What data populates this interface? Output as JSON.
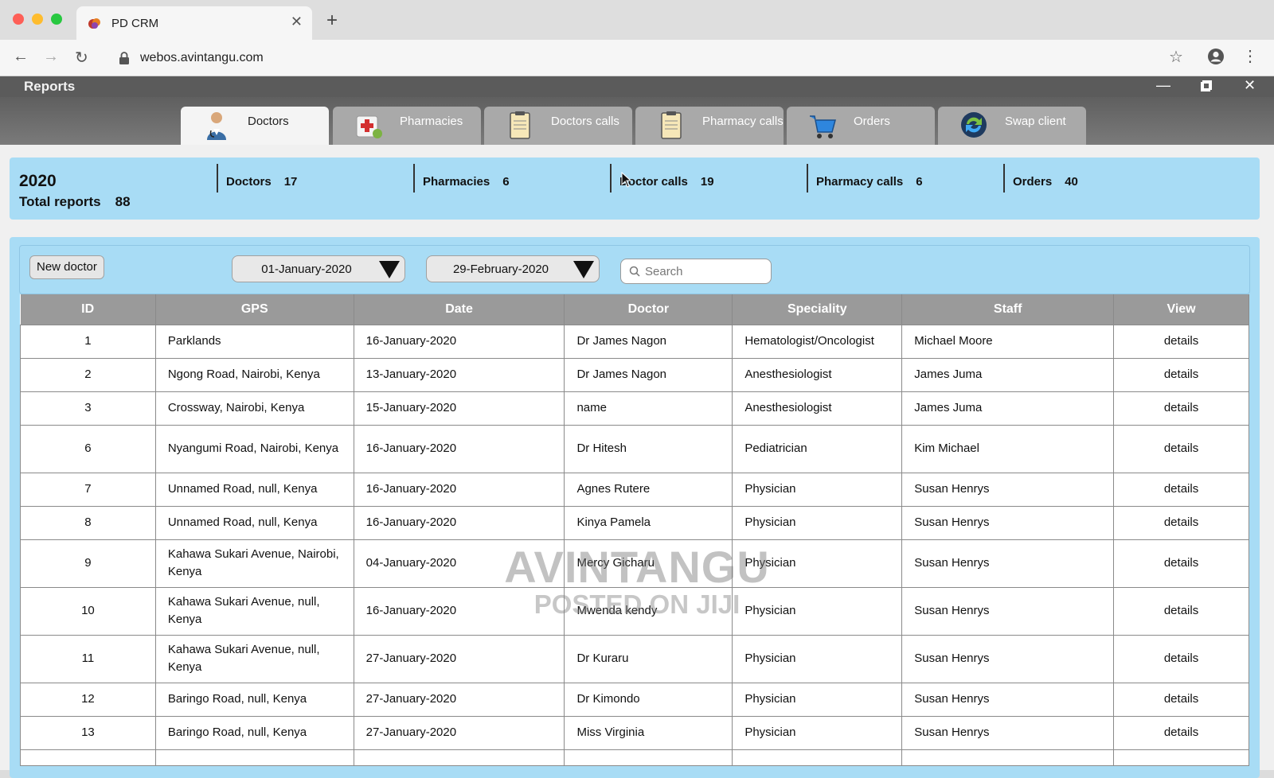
{
  "browser": {
    "tab_title": "PD CRM",
    "url": "webos.avintangu.com"
  },
  "app": {
    "title": "Reports",
    "modules": [
      {
        "label": "Doctors",
        "icon": "doctor-icon",
        "active": true
      },
      {
        "label": "Pharmacies",
        "icon": "pharmacy-icon",
        "active": false
      },
      {
        "label": "Doctors calls",
        "icon": "clipboard-icon",
        "active": false
      },
      {
        "label": "Pharmacy calls",
        "icon": "clipboard-icon",
        "active": false
      },
      {
        "label": "Orders",
        "icon": "cart-icon",
        "active": false
      },
      {
        "label": "Swap client",
        "icon": "swap-icon",
        "active": false
      }
    ]
  },
  "summary": {
    "year": "2020",
    "total_label": "Total reports",
    "total_value": "88",
    "stats": [
      {
        "label": "Doctors",
        "value": "17"
      },
      {
        "label": "Pharmacies",
        "value": "6"
      },
      {
        "label": "Doctor calls",
        "value": "19"
      },
      {
        "label": "Pharmacy calls",
        "value": "6"
      },
      {
        "label": "Orders",
        "value": "40"
      }
    ]
  },
  "filters": {
    "new_button": "New doctor",
    "date_from": "01-January-2020",
    "date_to": "29-February-2020",
    "search_placeholder": "Search"
  },
  "table": {
    "columns": [
      "ID",
      "GPS",
      "Date",
      "Doctor",
      "Speciality",
      "Staff",
      "View"
    ],
    "rows": [
      [
        "1",
        "Parklands",
        "16-January-2020",
        "Dr James Nagon",
        "Hematologist/Oncologist",
        "Michael Moore",
        "details"
      ],
      [
        "2",
        "Ngong Road, Nairobi, Kenya",
        "13-January-2020",
        "Dr James Nagon",
        "Anesthesiologist",
        "James Juma",
        "details"
      ],
      [
        "3",
        "Crossway, Nairobi, Kenya",
        "15-January-2020",
        "name",
        "Anesthesiologist",
        "James Juma",
        "details"
      ],
      [
        "6",
        "Nyangumi Road, Nairobi, Kenya",
        "16-January-2020",
        "Dr Hitesh",
        "Pediatrician",
        "Kim Michael",
        "details"
      ],
      [
        "7",
        "Unnamed Road, null, Kenya",
        "16-January-2020",
        "Agnes Rutere",
        "Physician",
        "Susan Henrys",
        "details"
      ],
      [
        "8",
        "Unnamed Road, null, Kenya",
        "16-January-2020",
        "Kinya Pamela",
        "Physician",
        "Susan Henrys",
        "details"
      ],
      [
        "9",
        "Kahawa Sukari Avenue, Nairobi, Kenya",
        "04-January-2020",
        "Mercy Gicharu",
        "Physician",
        "Susan Henrys",
        "details"
      ],
      [
        "10",
        "Kahawa Sukari Avenue, null, Kenya",
        "16-January-2020",
        "Mwenda kendy",
        "Physician",
        "Susan Henrys",
        "details"
      ],
      [
        "11",
        "Kahawa Sukari Avenue, null, Kenya",
        "27-January-2020",
        "Dr Kuraru",
        "Physician",
        "Susan Henrys",
        "details"
      ],
      [
        "12",
        "Baringo Road, null, Kenya",
        "27-January-2020",
        "Dr Kimondo",
        "Physician",
        "Susan Henrys",
        "details"
      ],
      [
        "13",
        "Baringo Road, null, Kenya",
        "27-January-2020",
        "Miss Virginia",
        "Physician",
        "Susan Henrys",
        "details"
      ]
    ]
  },
  "watermark": {
    "line1": "AVINTANGU",
    "line2": "POSTED ON JIJI"
  },
  "colors": {
    "panel": "#a8dcf5",
    "header": "#9a9a9a",
    "titlebar": "#5b5b5b"
  }
}
